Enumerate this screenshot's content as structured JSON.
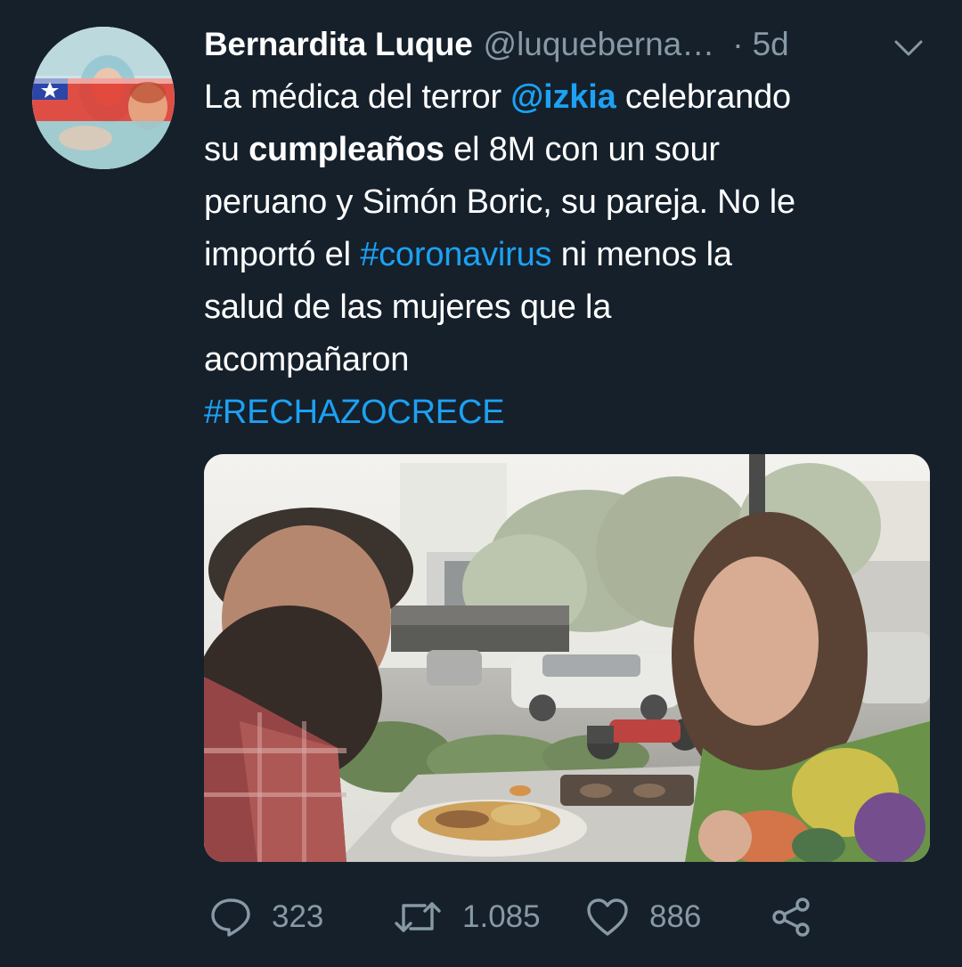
{
  "tweet": {
    "author_name": "Bernardita Luque",
    "author_handle": "@luqueberna…",
    "separator": "·",
    "time": "5d",
    "text": {
      "l1_a": "La médica del terror ",
      "l1_mention": "@izkia",
      "l1_b": " celebrando",
      "l2_a": "su ",
      "l2_bold": "cumpleaños",
      "l2_b": " el 8M con un sour",
      "l3": "peruano y Simón Boric, su pareja. No le",
      "l4_a": "importó el ",
      "l4_hashtag": "#coronavirus",
      "l4_b": " ni menos la",
      "l5": "salud de las mujeres que la",
      "l6": "acompañaron",
      "l7_hashtag": "#RECHAZOCRECE"
    }
  },
  "actions": {
    "reply_count": "323",
    "retweet_count": "1.085",
    "like_count": "886"
  },
  "colors": {
    "background": "#15202b",
    "link": "#1da1f2",
    "secondary_text": "#8899a6"
  },
  "icons": {
    "reply": "reply-icon",
    "retweet": "retweet-icon",
    "like": "heart-icon",
    "share": "share-icon",
    "more": "chevron-down-icon"
  }
}
